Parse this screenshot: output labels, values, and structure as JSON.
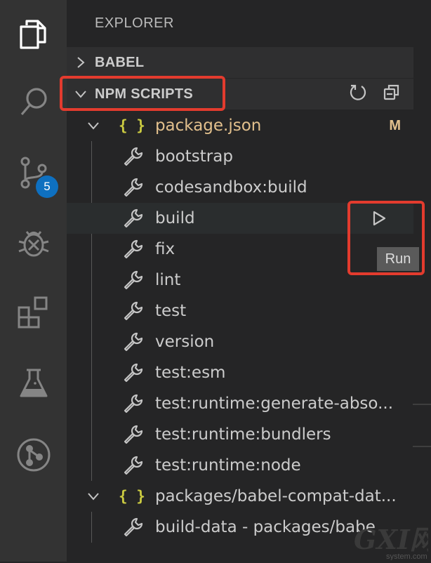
{
  "activity_bar": {
    "items": [
      "files-icon",
      "search-icon",
      "source-control-icon",
      "debug-icon",
      "extensions-icon",
      "testing-icon",
      "git-graph-icon"
    ],
    "scm_badge": "5",
    "badge_color": "#0e70c0"
  },
  "sidebar": {
    "title": "EXPLORER",
    "sections": {
      "babel": {
        "label": "BABEL",
        "expanded": false
      },
      "npm": {
        "label": "NPM SCRIPTS",
        "expanded": true,
        "actions": [
          "refresh-icon",
          "collapse-all-icon"
        ]
      }
    },
    "package": {
      "icon": "{ }",
      "name": "package.json",
      "status": "M",
      "scripts": [
        "bootstrap",
        "codesandbox:build",
        "build",
        "fix",
        "lint",
        "test",
        "version",
        "test:esm",
        "test:runtime:generate-abso...",
        "test:runtime:bundlers",
        "test:runtime:node"
      ]
    },
    "package2": {
      "icon": "{ }",
      "name": "packages/babel-compat-dat...",
      "scripts": [
        "build-data - packages/babe"
      ]
    },
    "hovered_script": "build",
    "tooltip": "Run"
  },
  "annotations": {
    "highlight_color": "#e33b2e"
  },
  "watermark": {
    "main": "GXI网",
    "sub": "system.com"
  }
}
